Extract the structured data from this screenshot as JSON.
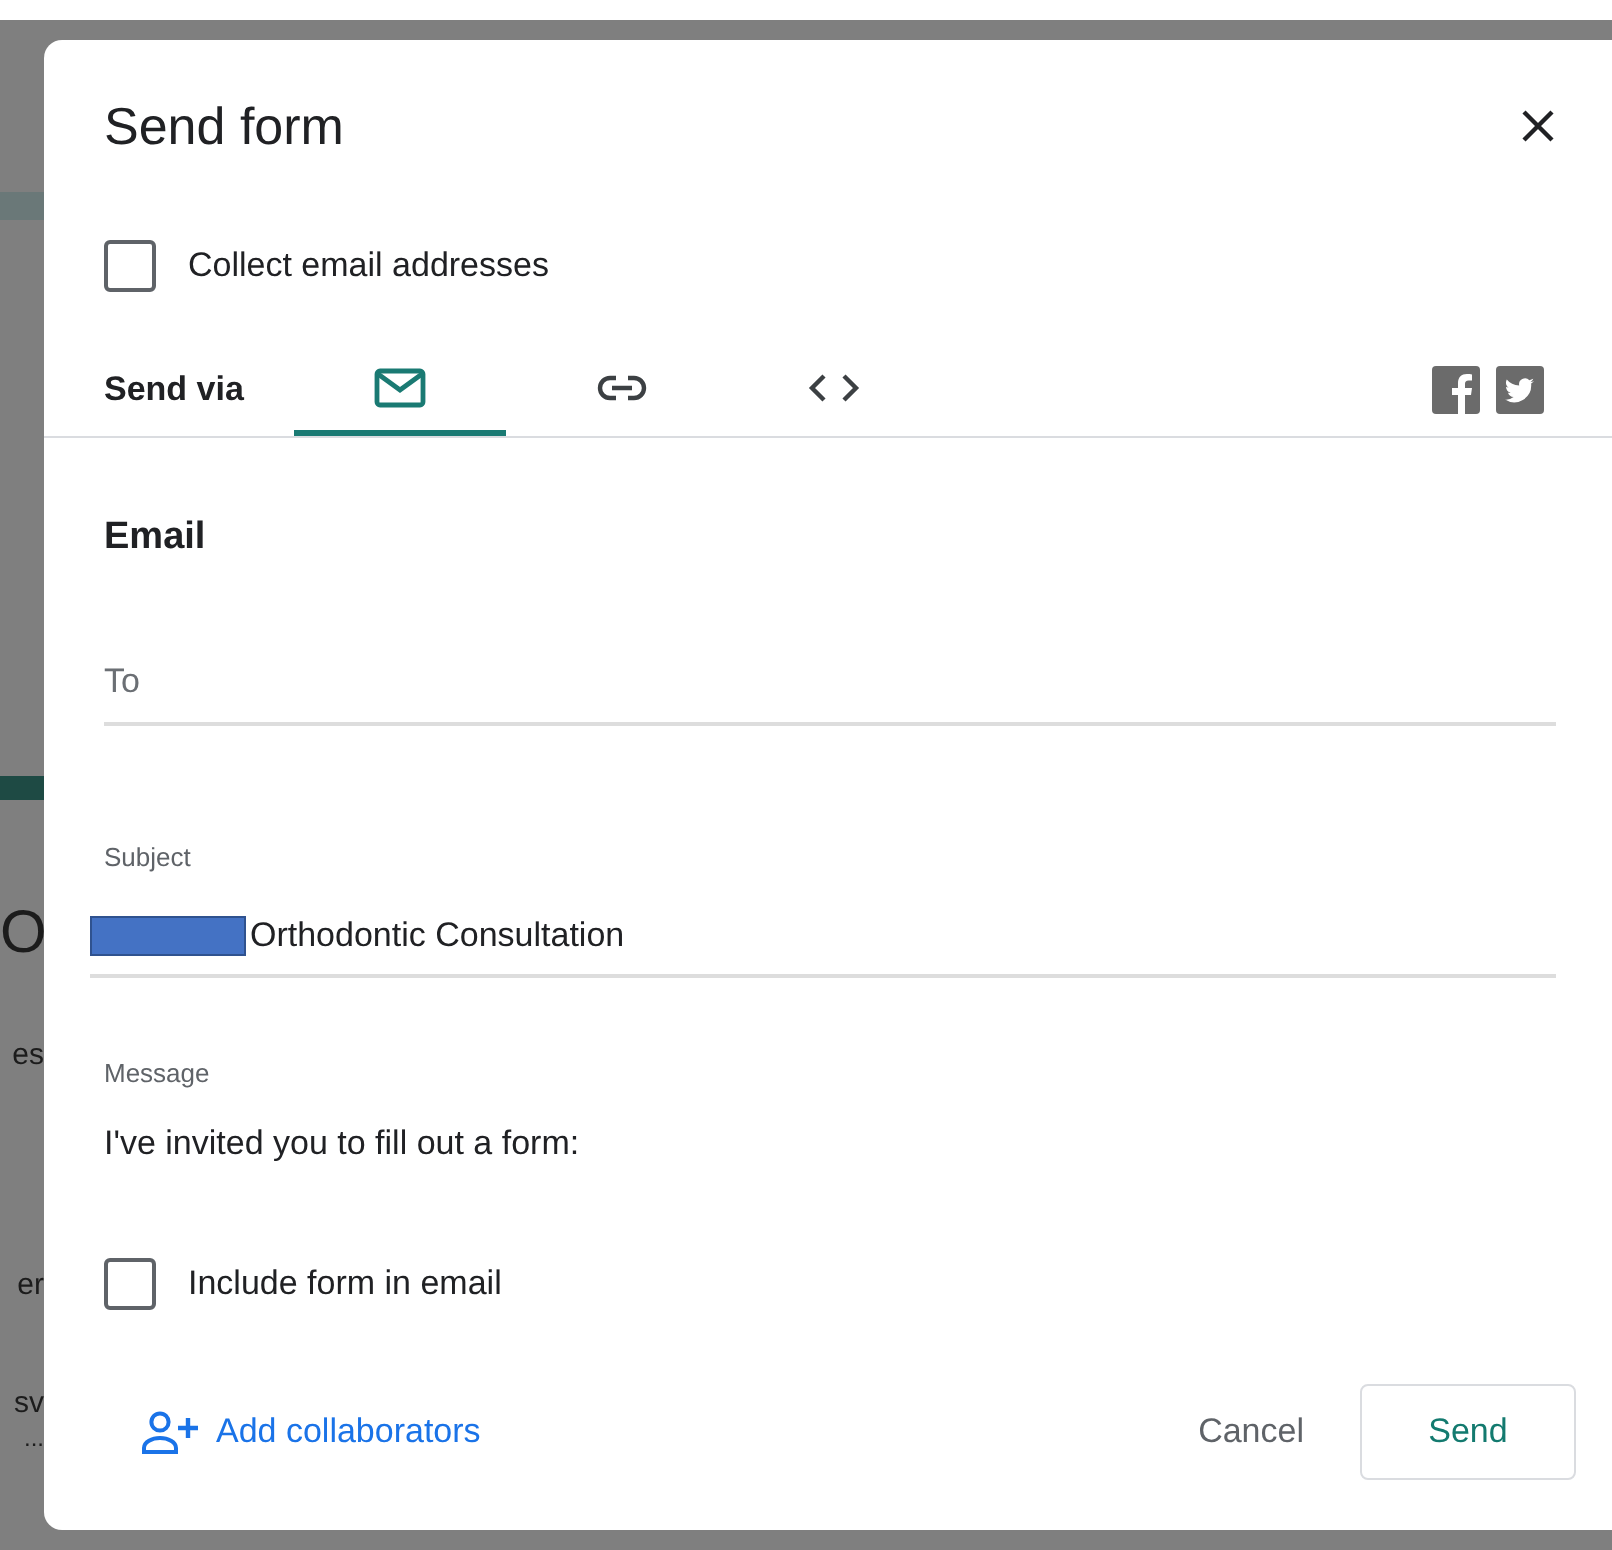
{
  "backdrop_fragments": [
    "O",
    "es",
    "er",
    "sv",
    "..."
  ],
  "window": {
    "title": "Send form"
  },
  "collect_email": {
    "label": "Collect email addresses",
    "checked": false
  },
  "send_via": {
    "label": "Send via",
    "tabs": [
      {
        "kind": "email",
        "selected": true
      },
      {
        "kind": "link",
        "selected": false
      },
      {
        "kind": "embed",
        "selected": false
      }
    ]
  },
  "email": {
    "heading": "Email",
    "to": {
      "placeholder": "To"
    },
    "subject": {
      "label": "Subject",
      "value": "Orthodontic Consultation"
    },
    "message": {
      "label": "Message",
      "value": "I've invited you to fill out a form:"
    }
  },
  "include_form": {
    "label": "Include form in email",
    "checked": false
  },
  "footer": {
    "add_collaborators": "Add collaborators",
    "cancel": "Cancel",
    "send": "Send"
  }
}
